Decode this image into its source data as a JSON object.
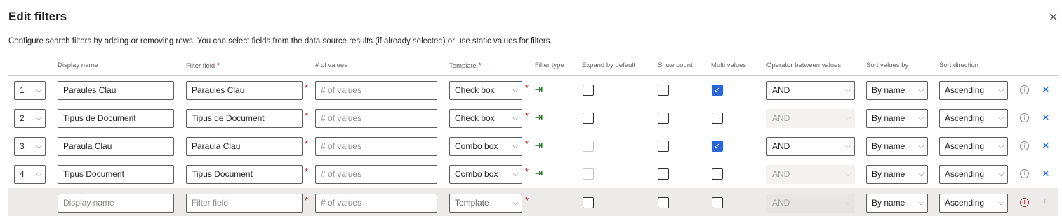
{
  "dialog": {
    "title": "Edit filters",
    "description": "Configure search filters by adding or removing rows. You can select fields from the data source results (if already selected) or use static values for filters.",
    "close_glyph": "✕"
  },
  "columns": {
    "display_name": "Display name",
    "filter_field": "Filter field",
    "num_values": "# of values",
    "template": "Template",
    "filter_type": "Filter type",
    "expand_by_default": "Expand by default",
    "show_count": "Show count",
    "multi_values": "Multi values",
    "operator": "Operator between values",
    "sort_by": "Sort values by",
    "sort_direction": "Sort direction",
    "required_marker": "*"
  },
  "rows": [
    {
      "index": "1",
      "display_name": "Paraules Clau",
      "filter_field": "Paraules Clau",
      "num_values_placeholder": "# of values",
      "template": "Check box",
      "filter_type_icon": "arrow-to-right-icon",
      "expand_by_default": false,
      "expand_disabled": false,
      "show_count": false,
      "multi_values": true,
      "operator": "AND",
      "operator_disabled": false,
      "sort_by": "By name",
      "sort_direction": "Ascending"
    },
    {
      "index": "2",
      "display_name": "Tipus de Document",
      "filter_field": "Tipus de Document",
      "num_values_placeholder": "# of values",
      "template": "Check box",
      "filter_type_icon": "arrow-to-right-icon",
      "expand_by_default": false,
      "expand_disabled": false,
      "show_count": false,
      "multi_values": false,
      "operator": "AND",
      "operator_disabled": true,
      "sort_by": "By name",
      "sort_direction": "Ascending"
    },
    {
      "index": "3",
      "display_name": "Paraula Clau",
      "filter_field": "Paraula Clau",
      "num_values_placeholder": "# of values",
      "template": "Combo box",
      "filter_type_icon": "arrow-to-right-icon",
      "expand_by_default": false,
      "expand_disabled": true,
      "show_count": false,
      "multi_values": true,
      "operator": "AND",
      "operator_disabled": false,
      "sort_by": "By name",
      "sort_direction": "Ascending"
    },
    {
      "index": "4",
      "display_name": "Tipus Document",
      "filter_field": "Tipus Document",
      "num_values_placeholder": "# of values",
      "template": "Combo box",
      "filter_type_icon": "arrow-to-right-icon",
      "expand_by_default": false,
      "expand_disabled": true,
      "show_count": false,
      "multi_values": false,
      "operator": "AND",
      "operator_disabled": true,
      "sort_by": "By name",
      "sort_direction": "Ascending"
    }
  ],
  "new_row": {
    "display_name_placeholder": "Display name",
    "filter_field_placeholder": "Filter field",
    "num_values_placeholder": "# of values",
    "template_placeholder": "Template",
    "operator": "AND",
    "sort_by": "By name",
    "sort_direction": "Ascending"
  },
  "icons": {
    "chevron": "⌵",
    "check": "✓",
    "arrow": "⇥",
    "info": "i",
    "error": "!",
    "remove": "✕",
    "add": "+"
  },
  "colors": {
    "accent": "#2b66d9",
    "required": "#a4262c",
    "filter_type_arrow": "#107c10",
    "new_row_background": "#edebe9"
  }
}
